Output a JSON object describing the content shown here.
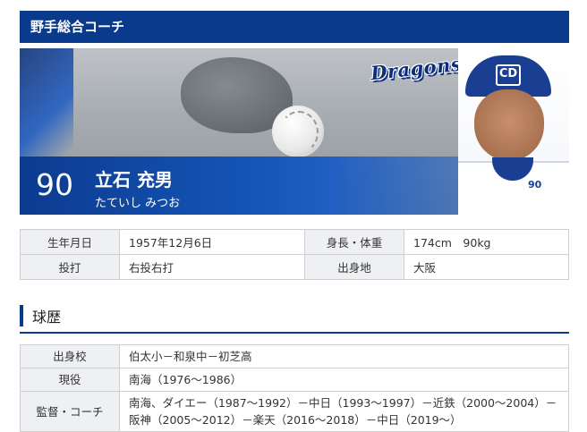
{
  "header": {
    "title": "野手総合コーチ"
  },
  "hero": {
    "team_logo": "Dragons",
    "uniform_number": "90",
    "name": "立石 充男",
    "name_kana": "たていし みつお",
    "cap_logo": "CD",
    "jersey_number": "90"
  },
  "profile": {
    "rows": [
      {
        "label1": "生年月日",
        "value1": "1957年12月6日",
        "label2": "身長・体重",
        "value2": "174cm　90kg"
      },
      {
        "label1": "投打",
        "value1": "右投右打",
        "label2": "出身地",
        "value2": "大阪"
      }
    ]
  },
  "career_section": {
    "title": "球歴",
    "rows": [
      {
        "label": "出身校",
        "value": "伯太小－和泉中－初芝高"
      },
      {
        "label": "現役",
        "value": "南海（1976～1986）"
      },
      {
        "label": "監督・コーチ",
        "value": "南海、ダイエー（1987～1992）－中日（1993～1997）－近鉄（2000～2004）－阪神（2005～2012）－楽天（2016～2018）－中日（2019～）"
      }
    ]
  },
  "colors": {
    "brand": "#0a3a8c",
    "header_cell_bg": "#eef0f3",
    "border": "#cfcfcf"
  }
}
